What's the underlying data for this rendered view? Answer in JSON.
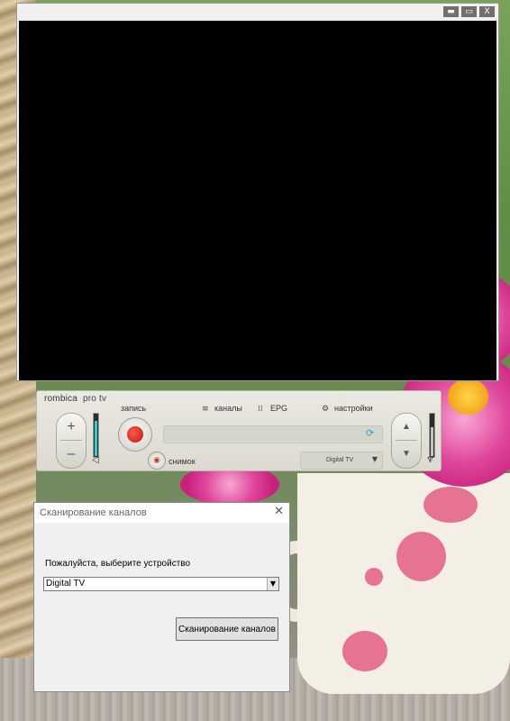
{
  "player": {
    "window_controls": {
      "minimize": "▬",
      "maximize": "▭",
      "close": "X"
    },
    "brand": {
      "name": "rombica",
      "product": "pro tv"
    },
    "record_label": "запись",
    "snapshot_label": "снимок",
    "nav": [
      {
        "icon": "list-icon",
        "glyph": "≡",
        "label": "каналы"
      },
      {
        "icon": "epg-icon",
        "glyph": "⁞⁞",
        "label": "EPG"
      },
      {
        "icon": "gear-icon",
        "glyph": "⚙",
        "label": "настройки"
      }
    ],
    "volume_plus": "+",
    "volume_minus": "–",
    "channel_up": "▲",
    "channel_down": "▼",
    "device_select": {
      "value": "Digital TV",
      "arrow": "▼"
    },
    "refresh_glyph": "⟳",
    "camera_glyph": "◉",
    "speaker_glyph": "◁",
    "antenna_glyph": "♆",
    "volume_level": 0.85,
    "signal_level": 0.7,
    "accent_color": "#c0160d"
  },
  "dialog": {
    "title": "Сканирование каналов",
    "close_glyph": "✕",
    "prompt": "Пожалуйста, выберите устройство",
    "device_combo": {
      "value": "Digital TV",
      "arrow": "▼"
    },
    "scan_button": "Сканирование каналов"
  }
}
